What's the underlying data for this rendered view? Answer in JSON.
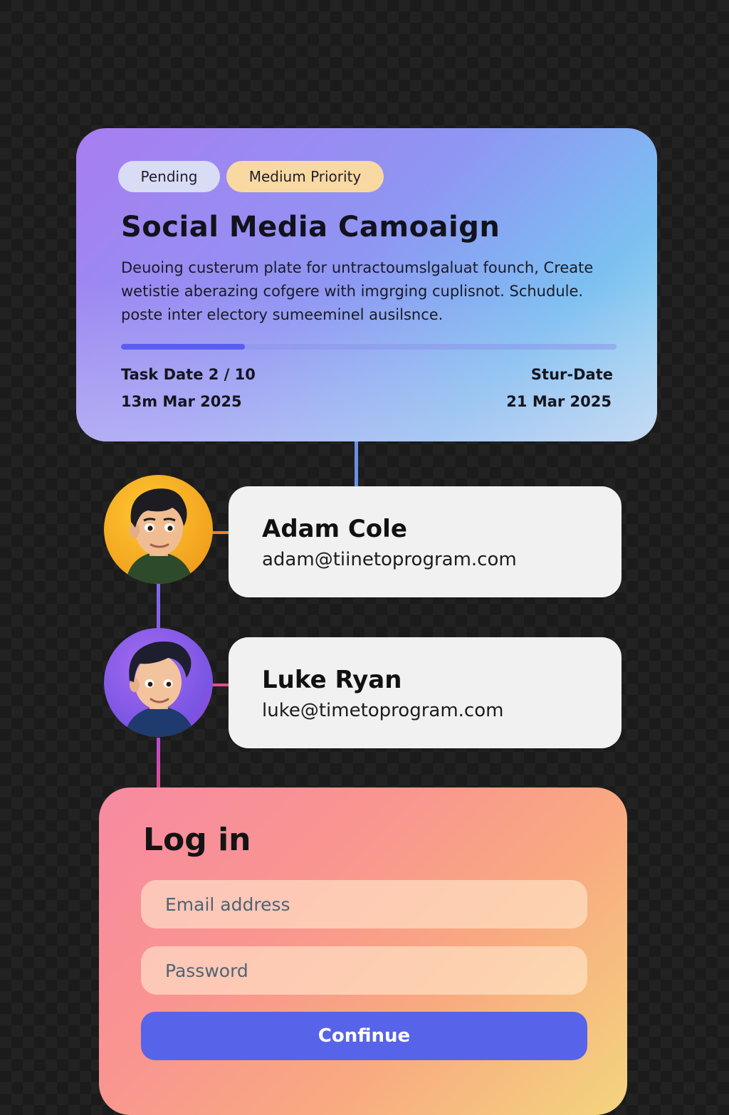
{
  "task": {
    "status_badge": "Pending",
    "priority_badge": "Medium Priority",
    "title": "Social Media Camoaign",
    "description": "Deuoing custerum plate for untractoumslgaluat founch, Create wetistie aberazing cofgere with imgrging cuplisnot. Schudule. poste inter electory sumeeminel ausilsnce.",
    "progress_fraction": 0.25,
    "task_date_label": "Task Date 2 / 10",
    "task_date_value": "13m Mar 2025",
    "start_date_label": "Stur-Date",
    "start_date_value": "21 Mar 2025",
    "colors": {
      "progress_fill": "#5a5ef0",
      "status_badge_bg": "#d9dcf5",
      "priority_badge_bg": "#f9d9a2"
    }
  },
  "members": [
    {
      "name": "Adam Cole",
      "email": "adam@tiinetoprogram.com",
      "avatar_icon": "avatar-man-orange-bg"
    },
    {
      "name": "Luke Ryan",
      "email": "luke@timetoprogram.com",
      "avatar_icon": "avatar-man-purple-bg"
    }
  ],
  "login": {
    "title": "Log in",
    "email_placeholder": "Email address",
    "password_placeholder": "Password",
    "confirm_label": "Confinue",
    "colors": {
      "button": "#5763e8"
    }
  }
}
